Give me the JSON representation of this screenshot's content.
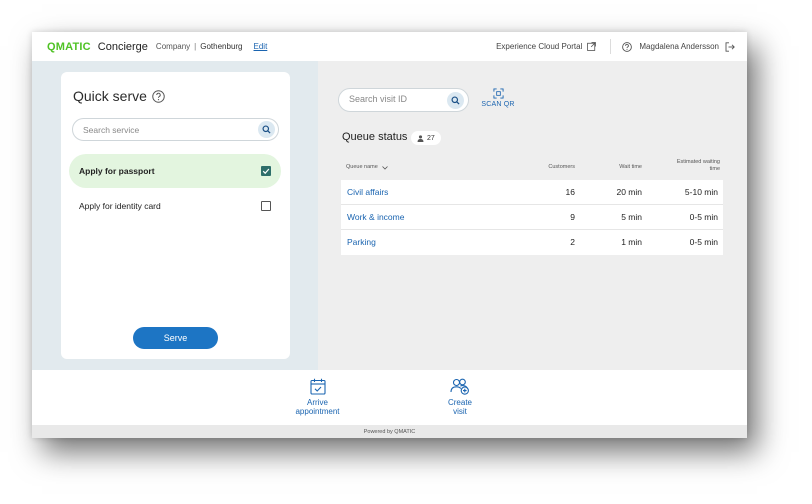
{
  "header": {
    "logo": "QMATIC",
    "app_name": "Concierge",
    "company_label": "Company",
    "separator": "|",
    "company_value": "Gothenburg",
    "edit_label": "Edit",
    "portal_label": "Experience Cloud Portal",
    "user_name": "Magdalena Andersson"
  },
  "quick_serve": {
    "title": "Quick serve",
    "search_placeholder": "Search service",
    "services": [
      {
        "label": "Apply for passport",
        "checked": true
      },
      {
        "label": "Apply for identity card",
        "checked": false
      }
    ],
    "serve_label": "Serve"
  },
  "visit": {
    "search_placeholder": "Search visit ID",
    "scan_label": "SCAN QR"
  },
  "queue_status": {
    "title": "Queue status",
    "count": "27",
    "columns": {
      "name": "Queue name",
      "customers": "Customers",
      "wait": "Wait time",
      "estimated_line1": "Estimated waiting",
      "estimated_line2": "time"
    },
    "rows": [
      {
        "name": "Civil affairs",
        "customers": "16",
        "wait": "20 min",
        "estimated": "5-10 min"
      },
      {
        "name": "Work & income",
        "customers": "9",
        "wait": "5 min",
        "estimated": "0-5 min"
      },
      {
        "name": "Parking",
        "customers": "2",
        "wait": "1 min",
        "estimated": "0-5 min"
      }
    ]
  },
  "actions": [
    {
      "line1": "Arrive",
      "line2": "appointment",
      "icon": "calendar-check-icon"
    },
    {
      "line1": "Create",
      "line2": "visit",
      "icon": "add-people-icon"
    }
  ],
  "footer": {
    "text": "Powered by QMATIC"
  },
  "colors": {
    "brand_green": "#4fc224",
    "link_blue": "#1a64b0",
    "primary_button": "#1d75c4",
    "selected_row": "#e3f5df",
    "checkbox_checked": "#2e6e6a"
  }
}
